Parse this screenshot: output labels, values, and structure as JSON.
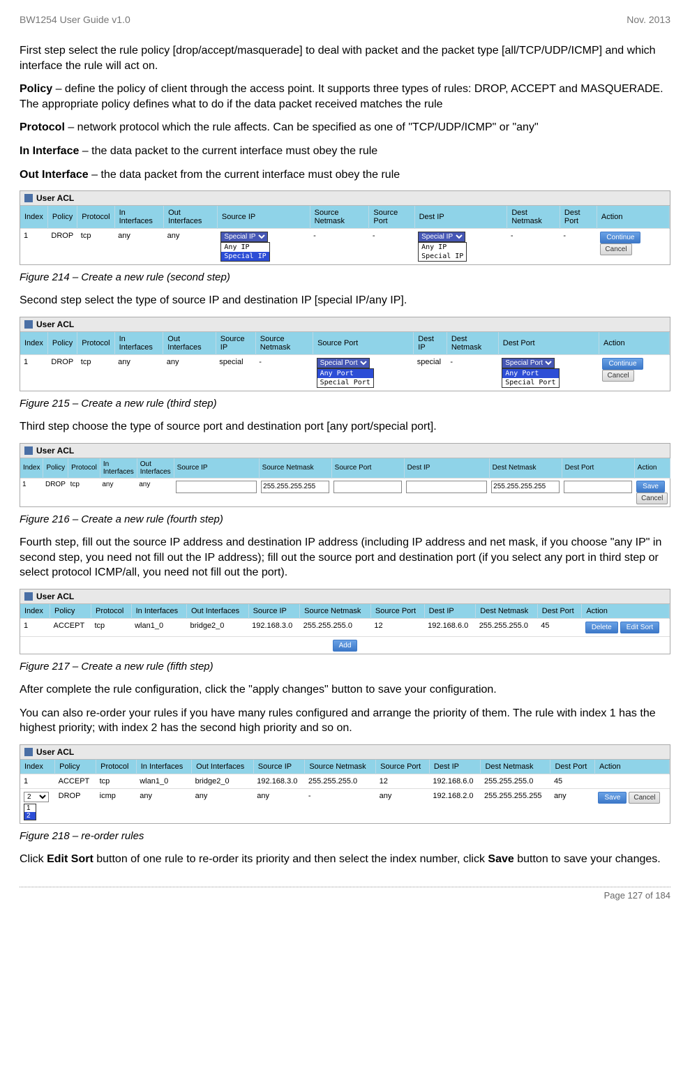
{
  "header": {
    "left": "BW1254 User Guide v1.0",
    "right": "Nov.  2013"
  },
  "p1": "First step select the rule policy [drop/accept/masquerade] to deal with packet and the packet type [all/TCP/UDP/ICMP] and which interface the rule will act on.",
  "p2a": "Policy",
  "p2b": " – define the policy of client through the access point. It supports three types of rules: DROP, ACCEPT and MASQUERADE. The appropriate policy defines what to do if the data packet received matches the rule",
  "p3a": "Protocol",
  "p3b": " – network protocol which the rule affects. Can be specified as one of \"TCP/UDP/ICMP\" or \"any\"",
  "p4a": "In Interface",
  "p4b": " – the data packet to the current interface must obey the rule",
  "p5a": "Out Interface",
  "p5b": " – the data packet from the current interface must obey the rule",
  "panelTitle": "User ACL",
  "hdrs": {
    "index": "Index",
    "policy": "Policy",
    "protocol": "Protocol",
    "inIf": "In Interfaces",
    "outIf": "Out Interfaces",
    "srcIp": "Source IP",
    "srcMask": "Source Netmask",
    "srcPort": "Source Port",
    "destIp": "Dest IP",
    "destMask": "Dest Netmask",
    "destPort": "Dest Port",
    "action": "Action"
  },
  "btns": {
    "continue": "Continue",
    "cancel": "Cancel",
    "save": "Save",
    "add": "Add",
    "delete": "Delete",
    "editSort": "Edit Sort"
  },
  "fig214": {
    "row": {
      "index": "1",
      "policy": "DROP",
      "protocol": "tcp",
      "inIf": "any",
      "outIf": "any",
      "srcMask": "-",
      "srcPort": "-",
      "destMask": "-",
      "destPort": "-"
    },
    "sel": {
      "visible": "Special IP",
      "opt1": "Any IP",
      "opt2": "Special IP"
    },
    "caption": "Figure 214 – Create a new rule (second step)"
  },
  "after214": "Second step select the type of source IP and destination IP [special IP/any IP].",
  "fig215": {
    "row": {
      "index": "1",
      "policy": "DROP",
      "protocol": "tcp",
      "inIf": "any",
      "outIf": "any",
      "srcIp": "special",
      "srcMask": "-",
      "destIp": "special",
      "destMask": "-"
    },
    "sel": {
      "visible": "Special Port",
      "opt1": "Any Port",
      "opt2": "Special Port"
    },
    "caption": "Figure 215 – Create a new rule (third step)"
  },
  "after215": "Third step choose the type of source port and destination port [any port/special port].",
  "fig216": {
    "row": {
      "index": "1",
      "policy": "DROP",
      "protocol": "tcp",
      "inIf": "any",
      "outIf": "any",
      "srcMaskVal": "255.255.255.255",
      "destMaskVal": "255.255.255.255"
    },
    "caption": "Figure 216 – Create a new rule (fourth step)"
  },
  "after216": "Fourth step, fill out the source IP address and destination IP address (including IP address and net mask, if you choose \"any IP\" in second step, you need not fill out the IP address); fill out the source port and destination port (if you select any port in third step or select protocol ICMP/all, you need not fill out the port).",
  "fig217": {
    "row": {
      "index": "1",
      "policy": "ACCEPT",
      "protocol": "tcp",
      "inIf": "wlan1_0",
      "outIf": "bridge2_0",
      "srcIp": "192.168.3.0",
      "srcMask": "255.255.255.0",
      "srcPort": "12",
      "destIp": "192.168.6.0",
      "destMask": "255.255.255.0",
      "destPort": "45"
    },
    "caption": "Figure 217 – Create a new rule (fifth step)"
  },
  "after217a": "After complete the rule configuration, click the \"apply changes\" button to save your configuration.",
  "after217b": "You can also re-order your rules if you have many rules configured and arrange the priority of them. The rule with index 1 has the highest priority; with index 2 has the second high priority and so on.",
  "fig218": {
    "rows": [
      {
        "index": "1",
        "policy": "ACCEPT",
        "protocol": "tcp",
        "inIf": "wlan1_0",
        "outIf": "bridge2_0",
        "srcIp": "192.168.3.0",
        "srcMask": "255.255.255.0",
        "srcPort": "12",
        "destIp": "192.168.6.0",
        "destMask": "255.255.255.0",
        "destPort": "45"
      },
      {
        "index": "2",
        "policy": "DROP",
        "protocol": "icmp",
        "inIf": "any",
        "outIf": "any",
        "srcIp": "any",
        "srcMask": "-",
        "srcPort": "any",
        "destIp": "192.168.2.0",
        "destMask": "255.255.255.255",
        "destPort": "any"
      }
    ],
    "selOpts": {
      "o1": "1",
      "o2": "2"
    },
    "caption": "Figure 218 – re-order rules"
  },
  "after218a1": "Click ",
  "after218a2": "Edit Sort",
  "after218a3": " button of one rule to re-order its priority and then select the index number, click ",
  "after218a4": "Save",
  "after218a5": " button to save your changes.",
  "footer": "Page 127 of 184"
}
